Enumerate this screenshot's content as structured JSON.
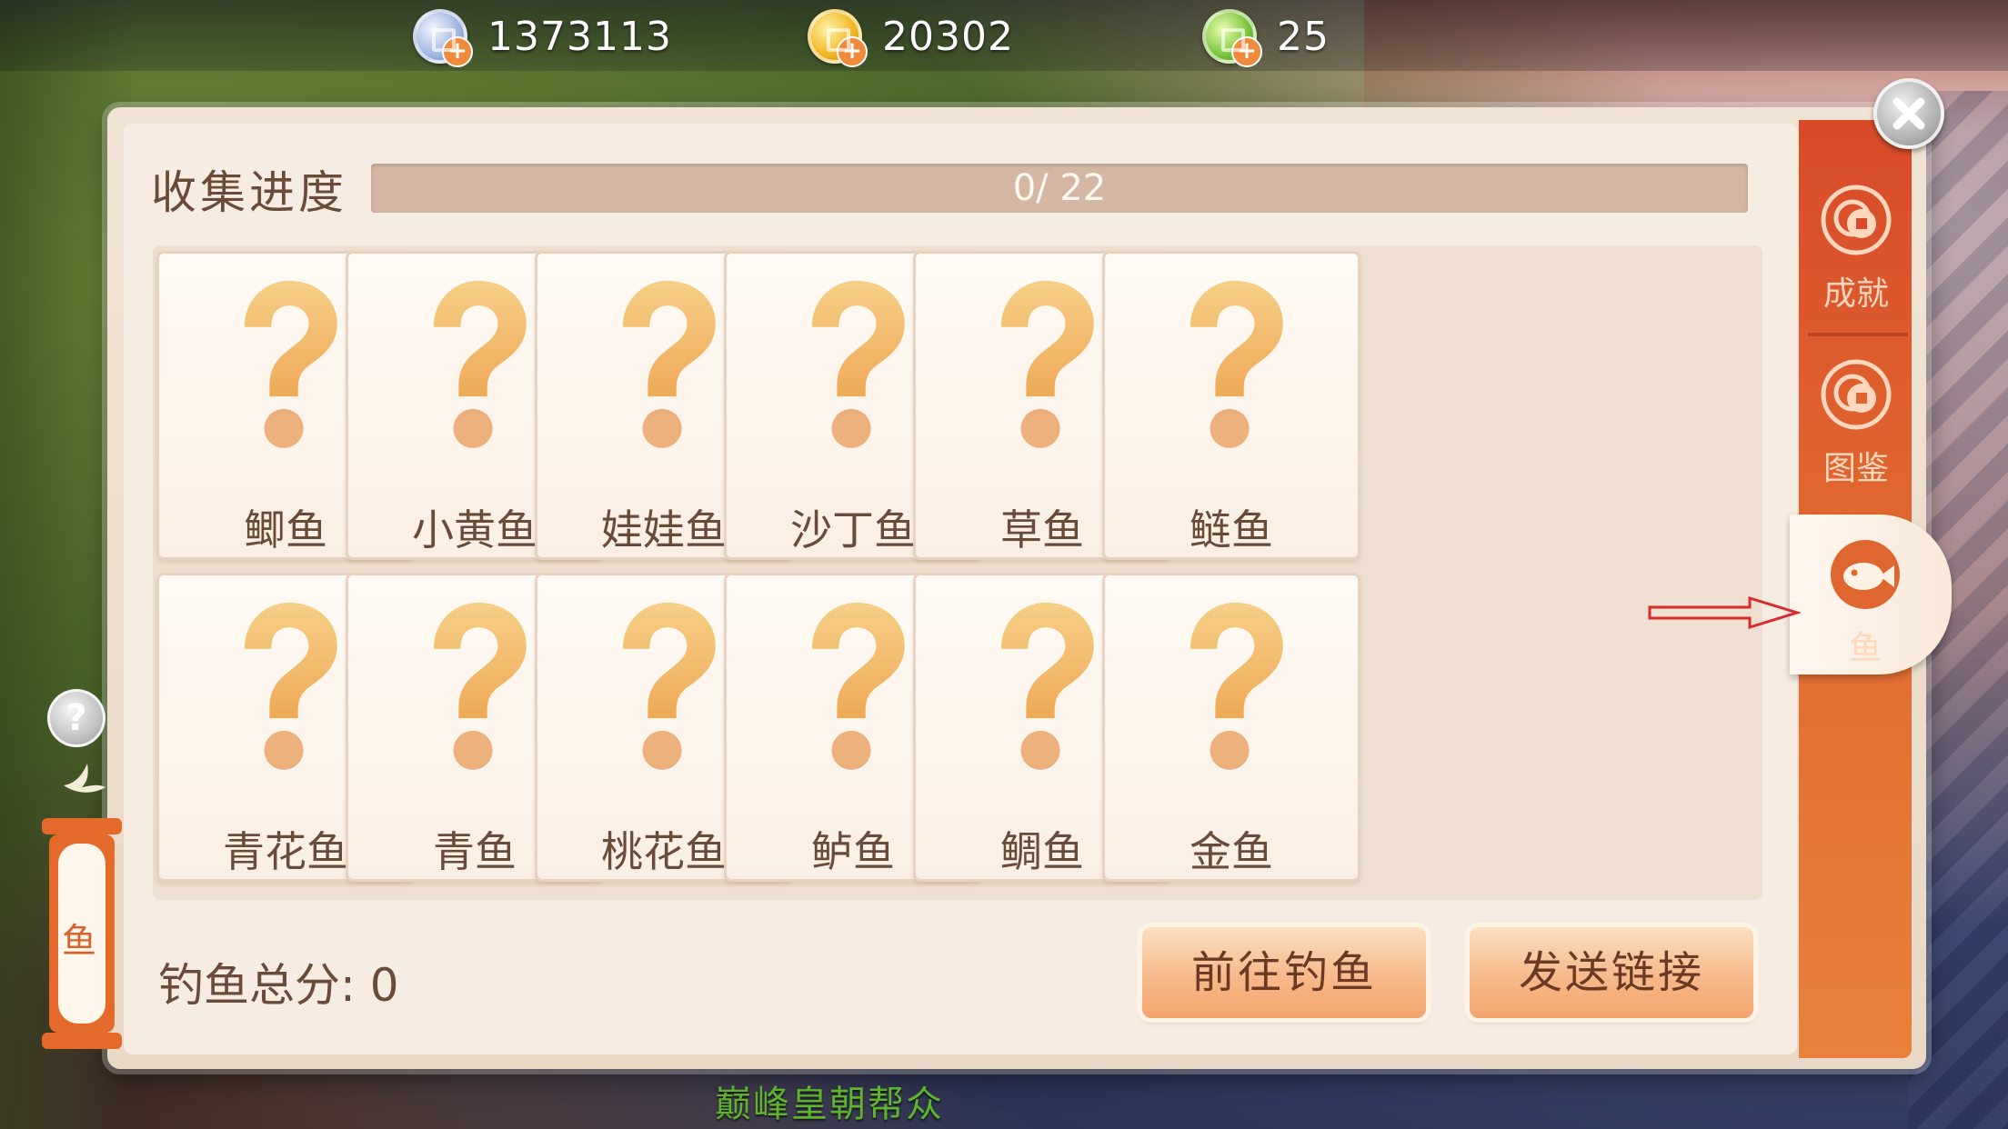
{
  "currencies": [
    {
      "icon": "silver-coin-icon",
      "value": "1373113"
    },
    {
      "icon": "gold-coin-icon",
      "value": "20302"
    },
    {
      "icon": "jade-coin-icon",
      "value": "25"
    }
  ],
  "collection": {
    "title": "收集进度",
    "progress_text": "0/ 22",
    "progress_fraction": 0
  },
  "fish_cards": [
    {
      "name": "鲫鱼",
      "status": "unknown"
    },
    {
      "name": "小黄鱼",
      "status": "unknown"
    },
    {
      "name": "娃娃鱼",
      "status": "unknown"
    },
    {
      "name": "沙丁鱼",
      "status": "unknown"
    },
    {
      "name": "草鱼",
      "status": "unknown"
    },
    {
      "name": "鲢鱼",
      "status": "unknown"
    },
    {
      "name": "青花鱼",
      "status": "unknown"
    },
    {
      "name": "青鱼",
      "status": "unknown"
    },
    {
      "name": "桃花鱼",
      "status": "unknown"
    },
    {
      "name": "鲈鱼",
      "status": "unknown"
    },
    {
      "name": "鲷鱼",
      "status": "unknown"
    },
    {
      "name": "金鱼",
      "status": "unknown"
    }
  ],
  "footer": {
    "score_label": "钓鱼总分: 0",
    "go_fishing_label": "前往钓鱼",
    "send_link_label": "发送链接"
  },
  "tabs": [
    {
      "label": "成就",
      "icon": "coin-badge-icon",
      "active": false
    },
    {
      "label": "图鉴",
      "icon": "coin-badge-icon",
      "active": false
    },
    {
      "label": "鱼",
      "icon": "fish-icon",
      "active": true
    }
  ],
  "side_widget": {
    "help_label": "?",
    "lantern_label": "鱼"
  },
  "bottom_caption": "巅峰皇朝帮众",
  "colors": {
    "accent_orange": "#e0662f",
    "panel_bg": "#f7ece1",
    "question_mark": "#f1b866",
    "text_brown": "#6a4b3a",
    "bottom_text_green": "#5fb32e"
  }
}
